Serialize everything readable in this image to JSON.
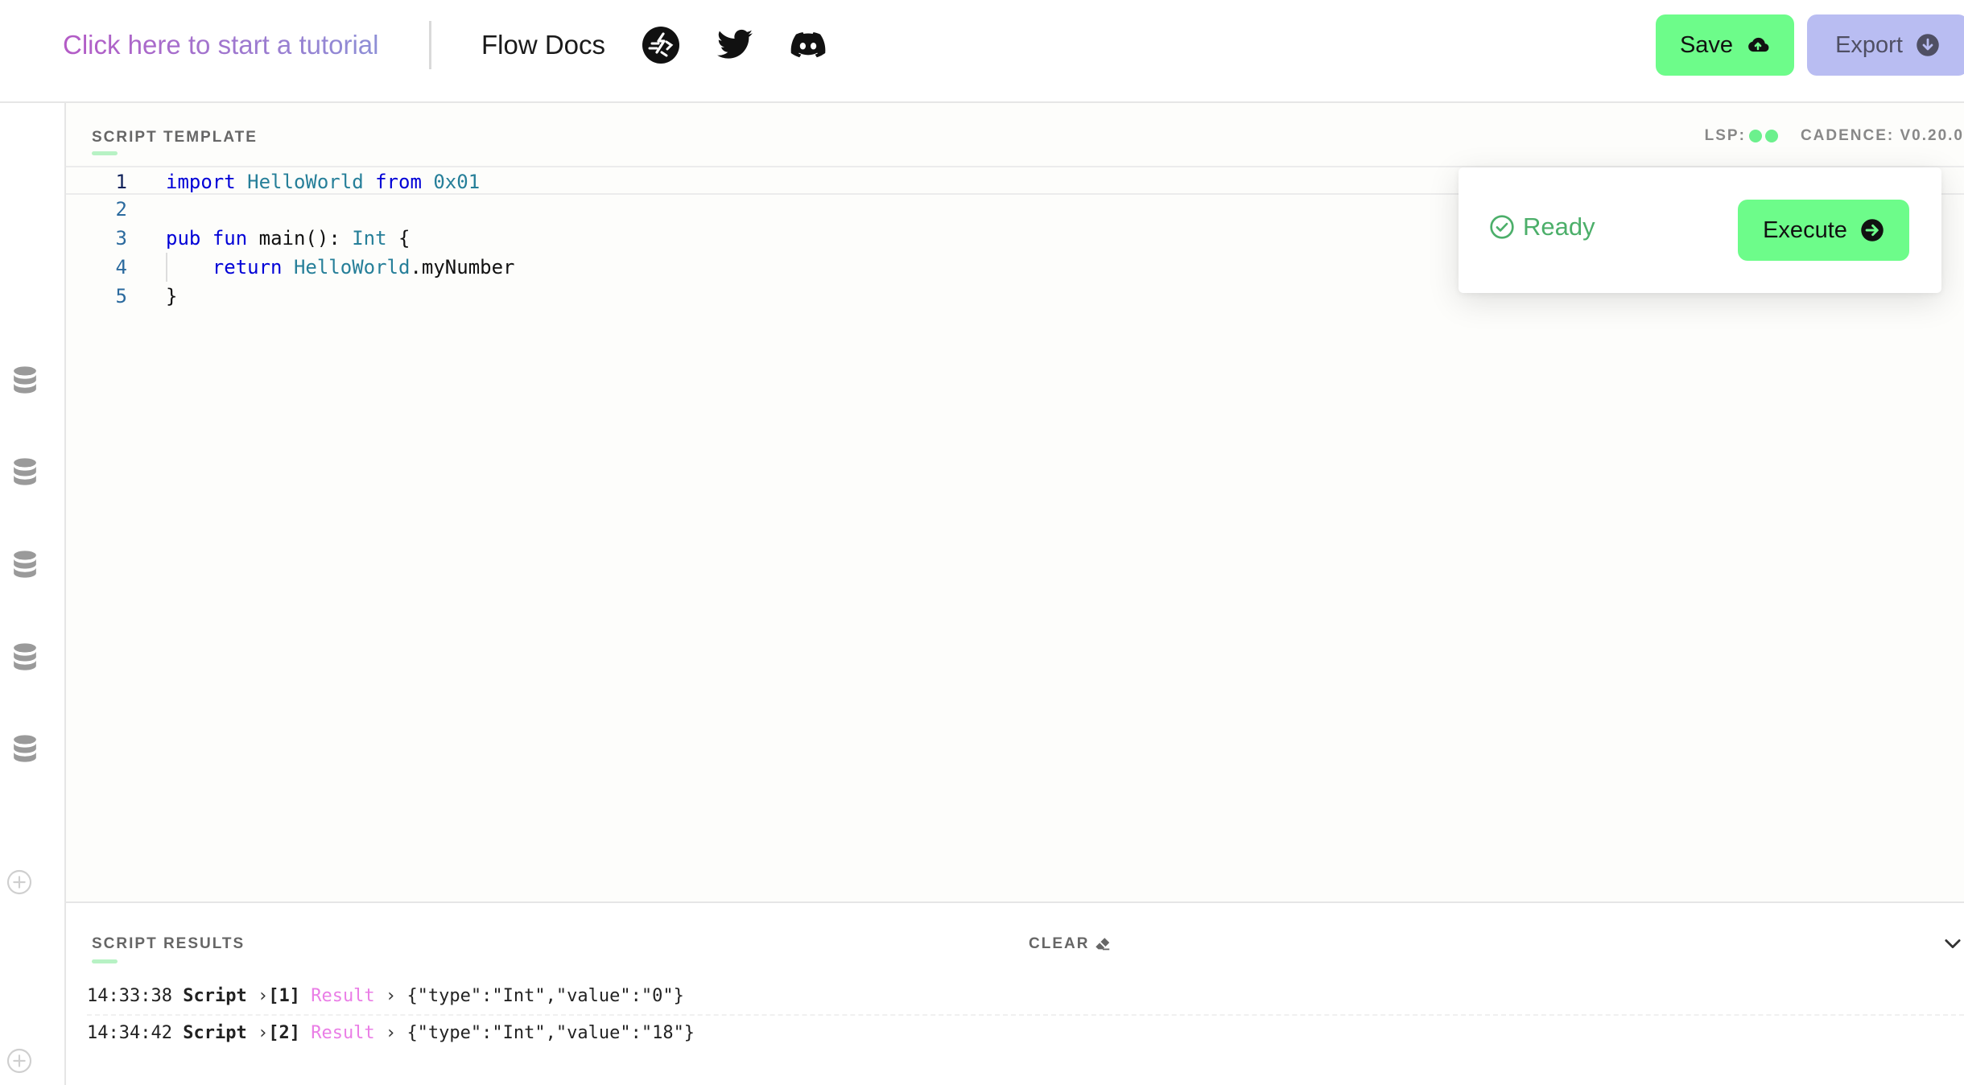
{
  "header": {
    "tutorial_label": "Click here to start a tutorial",
    "docs_label": "Flow Docs",
    "save_label": "Save",
    "export_label": "Export",
    "icons": [
      "flow-runner-icon",
      "twitter-icon",
      "discord-icon"
    ]
  },
  "editor": {
    "title": "SCRIPT TEMPLATE",
    "lsp_label": "LSP:",
    "cadence_label": "CADENCE: V0.20.0",
    "lines": [
      {
        "n": "1",
        "tokens": [
          {
            "t": "import",
            "c": "kw"
          },
          {
            "t": " ",
            "c": "plain"
          },
          {
            "t": "HelloWorld",
            "c": "ty"
          },
          {
            "t": " ",
            "c": "plain"
          },
          {
            "t": "from",
            "c": "kw"
          },
          {
            "t": " ",
            "c": "plain"
          },
          {
            "t": "0x01",
            "c": "ty"
          }
        ]
      },
      {
        "n": "2",
        "tokens": []
      },
      {
        "n": "3",
        "tokens": [
          {
            "t": "pub",
            "c": "kw"
          },
          {
            "t": " ",
            "c": "plain"
          },
          {
            "t": "fun",
            "c": "kw"
          },
          {
            "t": " main(): ",
            "c": "plain"
          },
          {
            "t": "Int",
            "c": "ty"
          },
          {
            "t": " {",
            "c": "plain"
          }
        ]
      },
      {
        "n": "4",
        "tokens": [
          {
            "t": "    ",
            "c": "plain"
          },
          {
            "t": "return",
            "c": "kw"
          },
          {
            "t": " ",
            "c": "plain"
          },
          {
            "t": "HelloWorld",
            "c": "ty"
          },
          {
            "t": ".myNumber",
            "c": "plain"
          }
        ]
      },
      {
        "n": "5",
        "tokens": [
          {
            "t": "}",
            "c": "plain"
          }
        ]
      }
    ]
  },
  "popover": {
    "status": "Ready",
    "execute_label": "Execute"
  },
  "results": {
    "title": "SCRIPT RESULTS",
    "clear_label": "CLEAR",
    "entries": [
      {
        "time": "14:33:38",
        "kind": "Script",
        "index": "[1]",
        "label": "Result",
        "value": "{\"type\":\"Int\",\"value\":\"0\"}"
      },
      {
        "time": "14:34:42",
        "kind": "Script",
        "index": "[2]",
        "label": "Result",
        "value": "{\"type\":\"Int\",\"value\":\"18\"}"
      }
    ]
  },
  "colors": {
    "accent_green": "#6dfc8a",
    "export_bg": "#b9bdf2",
    "ready_green": "#4caf6a",
    "result_pink": "#ea7ee6"
  }
}
